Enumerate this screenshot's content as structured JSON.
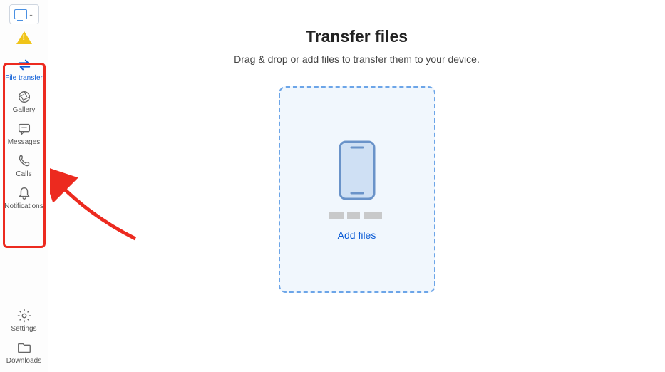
{
  "colors": {
    "accent": "#0b5cd6",
    "annotation": "#ec2a1f",
    "dropzone_bg": "#f1f7fd",
    "dropzone_border": "#6ca5e8"
  },
  "sidebar": {
    "device_selector": {
      "chevron": "⌄"
    },
    "warning_icon": "alert",
    "items": [
      {
        "name": "file-transfer",
        "label": "File transfer",
        "active": true,
        "icon": "swap"
      },
      {
        "name": "gallery",
        "label": "Gallery",
        "active": false,
        "icon": "aperture"
      },
      {
        "name": "messages",
        "label": "Messages",
        "active": false,
        "icon": "chat"
      },
      {
        "name": "calls",
        "label": "Calls",
        "active": false,
        "icon": "phone"
      },
      {
        "name": "notifications",
        "label": "Notifications",
        "active": false,
        "icon": "bell"
      }
    ],
    "bottom_items": [
      {
        "name": "settings",
        "label": "Settings",
        "icon": "gear"
      },
      {
        "name": "downloads",
        "label": "Downloads",
        "icon": "folder"
      }
    ]
  },
  "main": {
    "title": "Transfer files",
    "subtitle": "Drag & drop or add files to transfer them to your device.",
    "dropzone": {
      "device_name_redacted": true,
      "add_files_label": "Add files"
    }
  },
  "annotations": {
    "highlight_sidebar_items": true,
    "arrow_pointing_to_sidebar": true
  }
}
